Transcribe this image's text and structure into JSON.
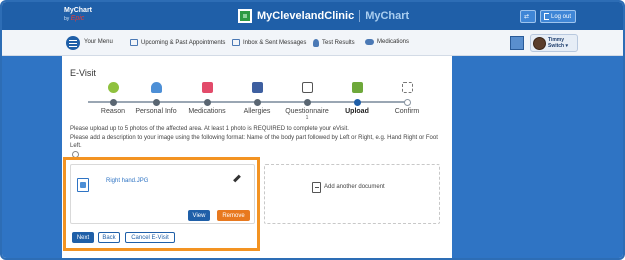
{
  "header": {
    "logo_line1": "MyChart",
    "logo_by": "by",
    "logo_epic": "Epic",
    "brand_name": "MyClevelandClinic",
    "brand_product": "MyChart",
    "logout_label": "Log out"
  },
  "nav": {
    "items": [
      {
        "label": "Your Menu",
        "icon": "menu-icon"
      },
      {
        "label": "Upcoming & Past Appointments",
        "icon": "calendar-icon"
      },
      {
        "label": "Inbox & Sent Messages",
        "icon": "envelope-icon"
      },
      {
        "label": "Test Results",
        "icon": "flask-icon"
      },
      {
        "label": "Medications",
        "icon": "pill-icon"
      }
    ],
    "user_first": "Timmy",
    "user_action": "Switch ▾"
  },
  "page": {
    "title": "E-Visit",
    "steps": [
      {
        "label": "Reason",
        "state": "done",
        "icon": "smiley-icon"
      },
      {
        "label": "Personal Info",
        "state": "done",
        "icon": "person-icon"
      },
      {
        "label": "Medications",
        "state": "done",
        "icon": "pill-bottle-icon"
      },
      {
        "label": "Allergies",
        "state": "done",
        "icon": "allergy-icon"
      },
      {
        "label": "Questionnaire",
        "sub": "1",
        "state": "done",
        "icon": "clipboard-icon"
      },
      {
        "label": "Upload",
        "state": "current",
        "icon": "upload-icon"
      },
      {
        "label": "Confirm",
        "state": "future",
        "icon": "flag-icon"
      }
    ],
    "instruction1": "Please upload up to 5 photos of the affected area. At least 1 photo is REQUIRED to complete your eVisit.",
    "instruction2": "Please add a description to your image using the following format: Name of the body part followed by Left or Right, e.g. Hand Right or Foot Left."
  },
  "upload": {
    "file_name": "Right hand.JPG",
    "view_label": "View",
    "remove_label": "Remove",
    "add_label": "Add another document"
  },
  "footer": {
    "next_label": "Next",
    "back_label": "Back",
    "cancel_label": "Cancel E-Visit"
  },
  "colors": {
    "brand_blue": "#1f5fa8",
    "side_blue": "#2f74c4",
    "highlight": "#f39322",
    "remove": "#e8791f"
  }
}
